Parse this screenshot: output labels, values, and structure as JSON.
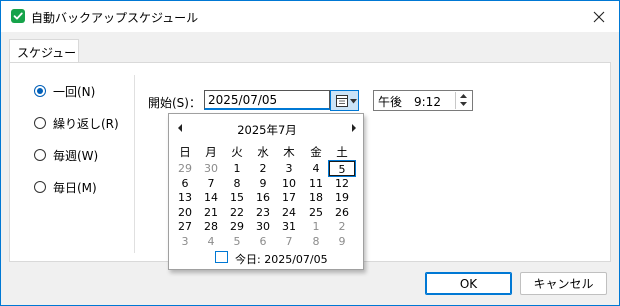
{
  "window": {
    "title": "自動バックアップスケジュール"
  },
  "tab": {
    "label": "スケジュール"
  },
  "radios": [
    {
      "label": "一回(N)",
      "checked": true
    },
    {
      "label": "繰り返し(R)",
      "checked": false
    },
    {
      "label": "毎週(W)",
      "checked": false
    },
    {
      "label": "毎日(M)",
      "checked": false
    }
  ],
  "start": {
    "label": "開始(S)：",
    "date": "2025/07/05",
    "time": "午後　9:12"
  },
  "calendar": {
    "month_title": "2025年7月",
    "weekdays": [
      "日",
      "月",
      "火",
      "水",
      "木",
      "金",
      "土"
    ],
    "weeks": [
      [
        "29",
        "30",
        "1",
        "2",
        "3",
        "4",
        "5"
      ],
      [
        "6",
        "7",
        "8",
        "9",
        "10",
        "11",
        "12"
      ],
      [
        "13",
        "14",
        "15",
        "16",
        "17",
        "18",
        "19"
      ],
      [
        "20",
        "21",
        "22",
        "23",
        "24",
        "25",
        "26"
      ],
      [
        "27",
        "28",
        "29",
        "30",
        "31",
        "1",
        "2"
      ],
      [
        "3",
        "4",
        "5",
        "6",
        "7",
        "8",
        "9"
      ]
    ],
    "selected_day": "5",
    "today_label": "今日: 2025/07/05"
  },
  "buttons": {
    "ok": "OK",
    "cancel": "キャンセル"
  },
  "colors": {
    "accent": "#0078d4",
    "app_icon": "#16a34a",
    "selected_bg": "#cce4f7"
  }
}
